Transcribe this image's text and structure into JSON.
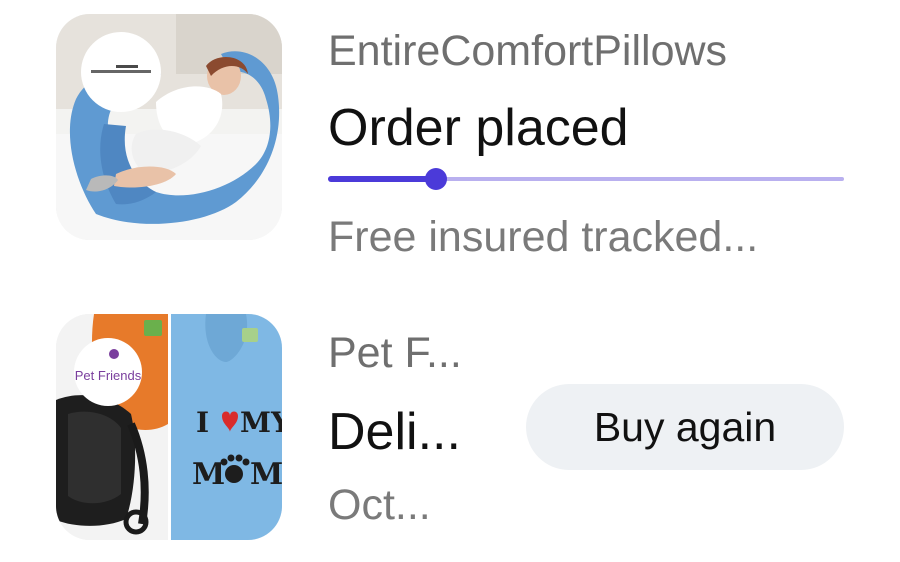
{
  "orders": [
    {
      "shop_name": "EntireComfortPillows",
      "status": "Order placed",
      "detail": "Free insured tracked...",
      "progress": 0.21,
      "colors": {
        "progress_fill": "#4b3ad9",
        "progress_track": "#b9b0ef"
      },
      "thumbnail": {
        "description_icon": "body-pillow-product-image"
      }
    },
    {
      "shop_name": "Pet F...",
      "status": "Deli...",
      "detail": "Oct...",
      "button_label": "Buy again",
      "thumbnail": {
        "description_icon": "pet-hoodie-product-image",
        "logo_text": "Pet Friends",
        "print_line1": "I",
        "print_line1b": "MY",
        "print_line2a": "M",
        "print_line2b": "M"
      }
    }
  ]
}
